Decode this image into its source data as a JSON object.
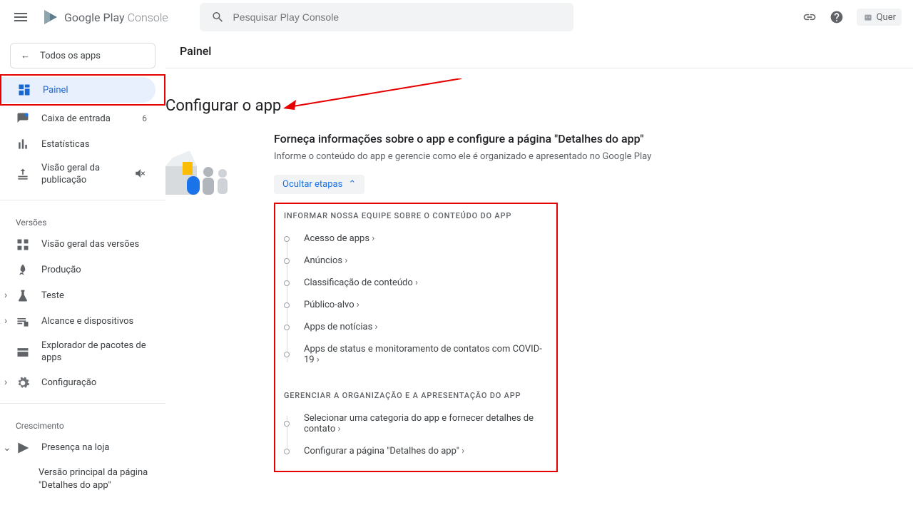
{
  "topbar": {
    "logo_text_primary": "Google Play",
    "logo_text_secondary": "Console",
    "search_placeholder": "Pesquisar Play Console",
    "pill_text": "Quer"
  },
  "sidebar": {
    "back_label": "Todos os apps",
    "painel": "Painel",
    "inbox": "Caixa de entrada",
    "inbox_count": "6",
    "stats": "Estatísticas",
    "publishing": "Visão geral da publicação",
    "versions_header": "Versões",
    "versions_overview": "Visão geral das versões",
    "production": "Produção",
    "test": "Teste",
    "reach": "Alcance e dispositivos",
    "explorer": "Explorador de pacotes de apps",
    "config": "Configuração",
    "growth_header": "Crescimento",
    "presence": "Presença na loja",
    "listing": "Versão principal da página \"Detalhes do app\""
  },
  "main": {
    "header": "Painel",
    "section_title": "Configurar o app",
    "config_heading": "Forneça informações sobre o app e configure a página \"Detalhes do app\"",
    "config_sub": "Informe o conteúdo do app e gerencie como ele é organizado e apresentado no Google Play",
    "hide_steps": "Ocultar etapas",
    "group1_label": "INFORMAR NOSSA EQUIPE SOBRE O CONTEÚDO DO APP",
    "steps1": [
      "Acesso de apps",
      "Anúncios",
      "Classificação de conteúdo",
      "Público-alvo",
      "Apps de notícias",
      "Apps de status e monitoramento de contatos com COVID-19"
    ],
    "group2_label": "GERENCIAR A ORGANIZAÇÃO E A APRESENTAÇÃO DO APP",
    "steps2": [
      "Selecionar uma categoria do app e fornecer detalhes de contato",
      "Configurar a página \"Detalhes do app\""
    ]
  }
}
